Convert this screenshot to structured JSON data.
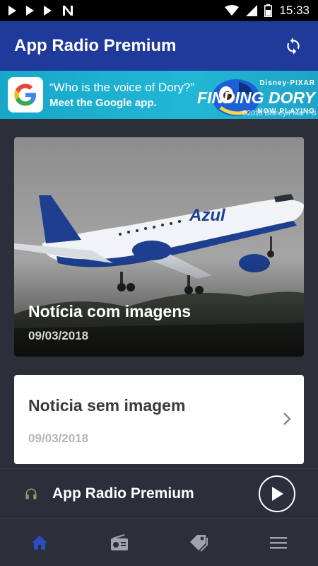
{
  "status_bar": {
    "time": "15:33",
    "left_icons": [
      "play-icon",
      "play-icon",
      "play-icon",
      "n-notification-icon"
    ],
    "right_icons": [
      "wifi-icon",
      "signal-icon",
      "battery-icon"
    ]
  },
  "app_bar": {
    "title": "App Radio Premium",
    "refresh_icon": "refresh-icon"
  },
  "ad": {
    "question": "“Who is the voice of Dory?”",
    "subtitle": "Meet the Google app.",
    "brand_top": "Disney·PIXAR",
    "brand_title": "FINDING DORY",
    "brand_tag": "NOW PLAYING",
    "footer": "©2016 Disney/Pixar PG"
  },
  "feed": {
    "items": [
      {
        "title": "Notícia com imagens",
        "date": "09/03/2018",
        "image": "airplane-photo"
      },
      {
        "title": "Noticia sem imagem",
        "date": "09/03/2018"
      }
    ]
  },
  "player": {
    "label": "App Radio Premium",
    "icon": "headphones-icon",
    "button_icon": "play-icon"
  },
  "bottom_nav": {
    "items": [
      {
        "name": "home",
        "icon": "home-icon",
        "active": true
      },
      {
        "name": "radio",
        "icon": "radio-icon",
        "active": false
      },
      {
        "name": "tags",
        "icon": "tag-icon",
        "active": false
      },
      {
        "name": "menu",
        "icon": "menu-icon",
        "active": false
      }
    ]
  },
  "colors": {
    "app_bar": "#203a9b",
    "background": "#2b2f3a",
    "active_nav": "#2c4bbf",
    "inactive_nav": "#9ea3ad",
    "ad_background": "#1fa9cb"
  }
}
